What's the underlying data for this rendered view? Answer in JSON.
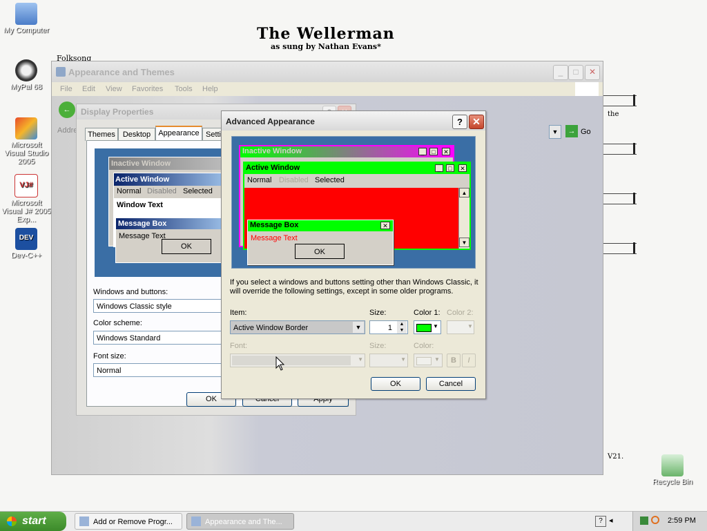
{
  "wallpaper": {
    "title": "The Wellerman",
    "subtitle": "as sung by Nathan Evans*",
    "note": "Folksong",
    "side_text_1": "the",
    "side_text_2": "V21."
  },
  "desktop_icons": [
    {
      "label": "My Computer",
      "icon": "computer-icon"
    },
    {
      "label": "MyPal 68",
      "icon": "raccoon-icon"
    },
    {
      "label": "Microsoft Visual Studio 2005",
      "icon": "visual-studio-icon"
    },
    {
      "label": "Microsoft Visual J# 2005 Exp...",
      "icon": "vj-icon"
    },
    {
      "label": "Dev-C++",
      "icon": "dev-icon"
    },
    {
      "label": "Recycle Bin",
      "icon": "recycle-bin-icon"
    }
  ],
  "explorer": {
    "title": "Appearance and Themes",
    "menu": [
      "File",
      "Edit",
      "View",
      "Favorites",
      "Tools",
      "Help"
    ],
    "address_label": "Addre",
    "go_label": "Go"
  },
  "display_properties": {
    "title": "Display Properties",
    "tabs": [
      "Themes",
      "Desktop",
      "Appearance",
      "Setti"
    ],
    "selected_tab": "Appearance",
    "preview": {
      "inactive": "Inactive Window",
      "active": "Active Window",
      "menu": [
        "Normal",
        "Disabled",
        "Selected"
      ],
      "window_text": "Window Text",
      "msgbox_title": "Message Box",
      "msgbox_text": "Message Text",
      "ok": "OK"
    },
    "windows_buttons_label": "Windows and buttons:",
    "windows_buttons_value": "Windows Classic style",
    "color_scheme_label": "Color scheme:",
    "color_scheme_value": "Windows Standard",
    "font_size_label": "Font size:",
    "font_size_value": "Normal",
    "ok": "OK",
    "cancel": "Cancel",
    "apply": "Apply"
  },
  "advanced": {
    "title": "Advanced Appearance",
    "help": "?",
    "close": "✕",
    "preview": {
      "inactive": "Inactive Window",
      "active": "Active Window",
      "menu": [
        "Normal",
        "Disabled",
        "Selected"
      ],
      "msgbox_title": "Message Box",
      "msgbox_text": "Message Text",
      "ok": "OK"
    },
    "info": "If you select a windows and buttons setting other than Windows Classic, it will override the following settings, except in some older programs.",
    "item_label": "Item:",
    "item_value": "Active Window Border",
    "size_label": "Size:",
    "size_value": "1",
    "color1_label": "Color 1:",
    "color2_label": "Color 2:",
    "font_label": "Font:",
    "font_size_label": "Size:",
    "font_color_label": "Color:",
    "bold": "B",
    "italic": "I",
    "ok": "OK",
    "cancel": "Cancel",
    "colors": {
      "inactive_bar": "#ff00ff",
      "active_bar": "#00ff00",
      "window_bg": "#ff0000",
      "msg_text": "#ff0000",
      "color1": "#00ff00"
    }
  },
  "taskbar": {
    "start": "start",
    "tasks": [
      "Add or Remove Progr...",
      "Appearance and The..."
    ],
    "clock": "2:59 PM"
  }
}
